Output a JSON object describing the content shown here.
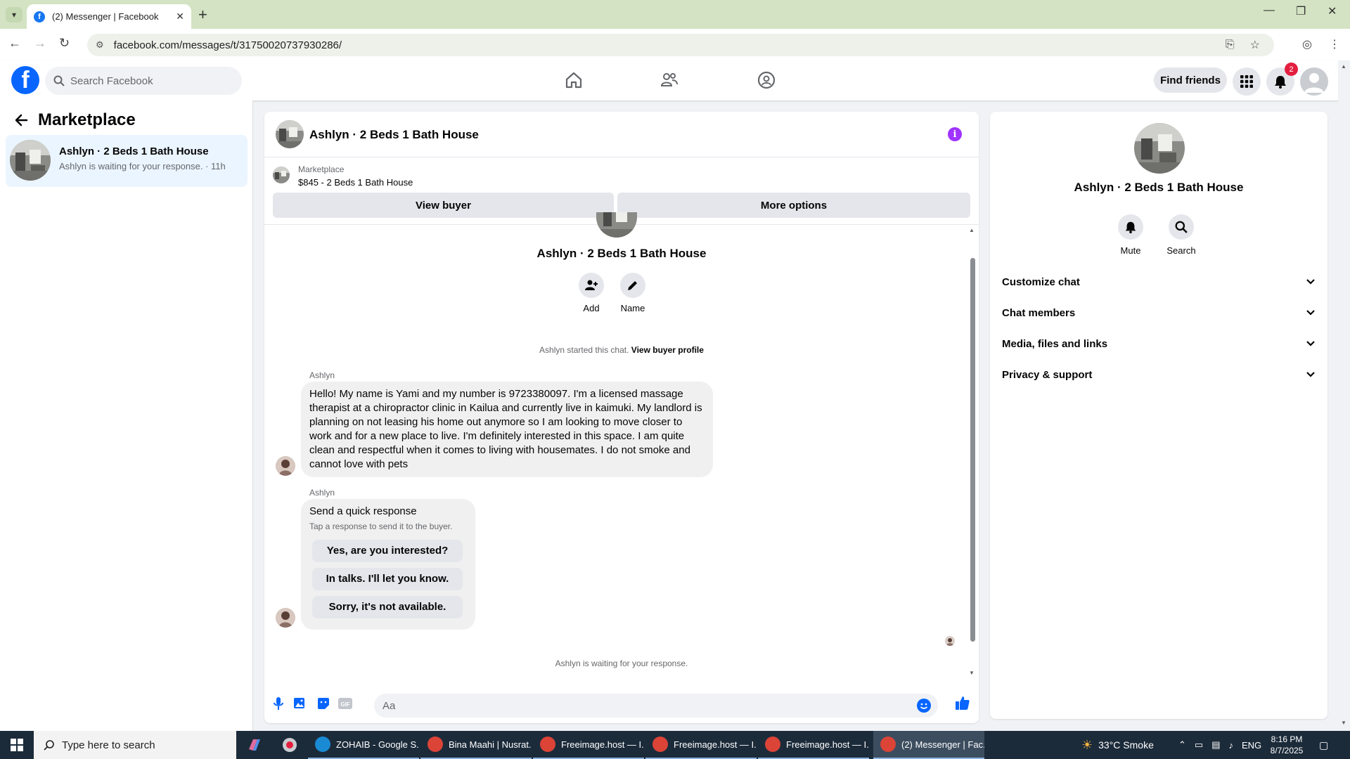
{
  "browser": {
    "tab_title": "(2) Messenger | Facebook",
    "url": "facebook.com/messages/t/31750020737930286/"
  },
  "header": {
    "search_placeholder": "Search Facebook",
    "find_friends": "Find friends",
    "notification_count": "2"
  },
  "sidebar": {
    "title": "Marketplace",
    "conversation": {
      "name": "Ashlyn · 2 Beds 1 Bath House",
      "preview": "Ashlyn is waiting for your response. · 11h"
    }
  },
  "chat": {
    "title": "Ashlyn · 2 Beds 1 Bath House",
    "marketplace_label": "Marketplace",
    "listing": "$845 - 2 Beds 1 Bath House",
    "view_buyer": "View buyer",
    "more_options": "More options",
    "center_name": "Ashlyn · 2 Beds 1 Bath House",
    "actions": {
      "add": "Add",
      "name": "Name"
    },
    "started_text": "Ashlyn started this chat.",
    "view_buyer_profile": "View buyer profile",
    "messages": [
      {
        "sender": "Ashlyn",
        "text": "Hello! My name is Yami and my number is 9723380097. I'm a licensed massage therapist at a chiropractor clinic in Kailua and currently live in kaimuki. My landlord is planning on not leasing his home out anymore so I am looking to move closer to work and for a new place to live. I'm definitely interested in this space. I am quite clean and respectful when it comes to living with housemates. I do not smoke and cannot love with pets"
      },
      {
        "sender": "Ashlyn",
        "quick_title": "Send a quick response",
        "quick_sub": "Tap a response to send it to the buyer.",
        "responses": [
          "Yes, are you interested?",
          "In talks. I'll let you know.",
          "Sorry, it's not available."
        ]
      }
    ],
    "waiting_text": "Ashlyn is waiting for your response.",
    "composer_placeholder": "Aa"
  },
  "right_panel": {
    "name": "Ashlyn · 2 Beds 1 Bath House",
    "mute": "Mute",
    "search": "Search",
    "sections": [
      "Customize chat",
      "Chat members",
      "Media, files and links",
      "Privacy & support"
    ]
  },
  "taskbar": {
    "search_placeholder": "Type here to search",
    "items": [
      "ZOHAIB - Google S...",
      "Bina Maahi | Nusrat...",
      "Freeimage.host — I...",
      "Freeimage.host — I...",
      "Freeimage.host — I...",
      "(2) Messenger | Fac..."
    ],
    "weather": "33°C  Smoke",
    "lang": "ENG",
    "time": "8:16 PM",
    "date": "8/7/2025"
  },
  "colors": {
    "fb_blue": "#0866ff",
    "info_purple": "#a033ff",
    "badge_red": "#e41e3f",
    "tab_bar": "#d3e3c3"
  }
}
